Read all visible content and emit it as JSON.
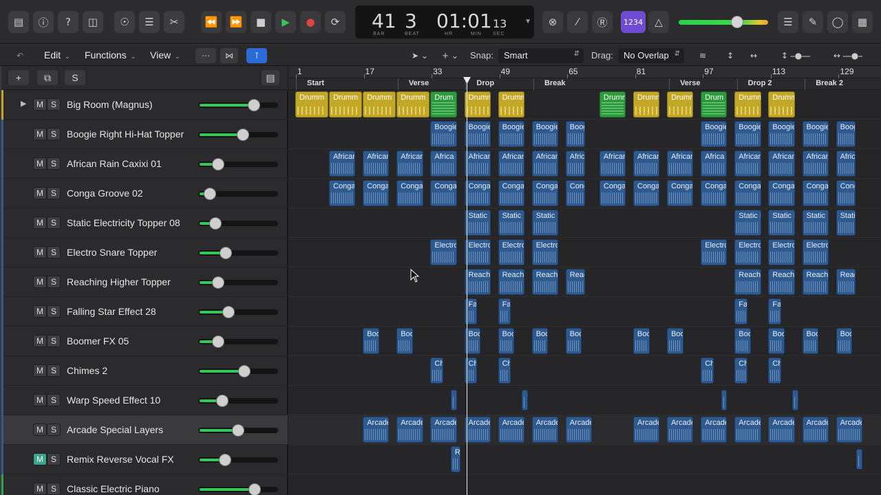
{
  "lcd": {
    "bar": "41",
    "beat": "3",
    "bar_label": "BAR",
    "beat_label": "BEAT",
    "time": "01:01",
    "time_frames": "13",
    "hr_label": "HR",
    "min_label": "MIN",
    "sec_label": "SEC"
  },
  "topbar": {
    "count_in_label": "1234",
    "master_volume_fraction": 0.68
  },
  "toolbar2": {
    "edit": "Edit",
    "functions": "Functions",
    "view": "View",
    "snap_label": "Snap:",
    "snap_value": "Smart",
    "drag_label": "Drag:",
    "drag_value": "No Overlap"
  },
  "header": {
    "s_button": "S"
  },
  "ruler": [
    "1",
    "17",
    "33",
    "49",
    "65",
    "81",
    "97",
    "113",
    "129"
  ],
  "markers": [
    "Start",
    "Verse",
    "Drop",
    "Break",
    "Verse",
    "Drop 2",
    "Break 2"
  ],
  "tracks": [
    {
      "name": "Big Room (Magnus)",
      "m": "M",
      "s": "S",
      "color": "#c3a726",
      "level": 0.72,
      "muted": false
    },
    {
      "name": "Boogie Right Hi-Hat Topper",
      "m": "M",
      "s": "S",
      "color": "#2e5a8f",
      "level": 0.58,
      "muted": false
    },
    {
      "name": "African Rain Caxixi 01",
      "m": "M",
      "s": "S",
      "color": "#2e5a8f",
      "level": 0.26,
      "muted": false
    },
    {
      "name": "Conga Groove 02",
      "m": "M",
      "s": "S",
      "color": "#2e5a8f",
      "level": 0.15,
      "muted": false
    },
    {
      "name": "Static Electricity Topper 08",
      "m": "M",
      "s": "S",
      "color": "#2e5a8f",
      "level": 0.22,
      "muted": false
    },
    {
      "name": "Electro Snare Topper",
      "m": "M",
      "s": "S",
      "color": "#2e5a8f",
      "level": 0.36,
      "muted": false
    },
    {
      "name": "Reaching Higher Topper",
      "m": "M",
      "s": "S",
      "color": "#2e5a8f",
      "level": 0.26,
      "muted": false
    },
    {
      "name": "Falling Star Effect 28",
      "m": "M",
      "s": "S",
      "color": "#2e5a8f",
      "level": 0.39,
      "muted": false
    },
    {
      "name": "Boomer FX 05",
      "m": "M",
      "s": "S",
      "color": "#2e5a8f",
      "level": 0.26,
      "muted": false
    },
    {
      "name": "Chimes 2",
      "m": "M",
      "s": "S",
      "color": "#2e5a8f",
      "level": 0.6,
      "muted": false
    },
    {
      "name": "Warp Speed Effect 10",
      "m": "M",
      "s": "S",
      "color": "#2e5a8f",
      "level": 0.31,
      "muted": false
    },
    {
      "name": "Arcade Special Layers",
      "m": "M",
      "s": "S",
      "color": "#2e5a8f",
      "level": 0.52,
      "muted": false
    },
    {
      "name": "Remix Reverse Vocal FX",
      "m": "M",
      "s": "S",
      "color": "#2e5a8f",
      "level": 0.35,
      "muted": true
    },
    {
      "name": "Classic Electric Piano",
      "m": "M",
      "s": "S",
      "color": "#2fa14a",
      "level": 0.73,
      "muted": false
    }
  ],
  "regions": [
    [
      {
        "label": "Drumm",
        "k": "drum",
        "b": 1,
        "e": 6
      },
      {
        "label": "Drumm",
        "k": "drum",
        "b": 6,
        "e": 11
      },
      {
        "label": "Drumm",
        "k": "drum",
        "b": 11,
        "e": 16
      },
      {
        "label": "Drumm",
        "k": "drum",
        "b": 16,
        "e": 21
      },
      {
        "label": "Drum",
        "k": "drumg",
        "b": 21,
        "e": 25
      },
      {
        "label": "Drumm",
        "k": "drum",
        "b": 26,
        "e": 30
      },
      {
        "label": "Drumm",
        "k": "drum",
        "b": 31,
        "e": 35
      },
      {
        "label": "Drumm",
        "k": "drumg",
        "b": 46,
        "e": 50
      },
      {
        "label": "Drumm",
        "k": "drum",
        "b": 51,
        "e": 55
      },
      {
        "label": "Drumm",
        "k": "drum",
        "b": 56,
        "e": 60
      },
      {
        "label": "Drum",
        "k": "drumg",
        "b": 61,
        "e": 65
      },
      {
        "label": "Drumm",
        "k": "drum",
        "b": 66,
        "e": 70
      },
      {
        "label": "Drumm",
        "k": "drum",
        "b": 71,
        "e": 75
      }
    ],
    [
      {
        "label": "Boogie",
        "k": "audio",
        "b": 21,
        "e": 25
      },
      {
        "label": "Boogie",
        "k": "audio",
        "b": 26,
        "e": 30
      },
      {
        "label": "Boogie",
        "k": "audio",
        "b": 31,
        "e": 35
      },
      {
        "label": "Boogie",
        "k": "audio",
        "b": 36,
        "e": 40
      },
      {
        "label": "Boogi",
        "k": "audio",
        "b": 41,
        "e": 44
      },
      {
        "label": "Boogie",
        "k": "audio",
        "b": 61,
        "e": 65
      },
      {
        "label": "Boogie",
        "k": "audio",
        "b": 66,
        "e": 70
      },
      {
        "label": "Boogie",
        "k": "audio",
        "b": 71,
        "e": 75
      },
      {
        "label": "Boogie",
        "k": "audio",
        "b": 76,
        "e": 80
      },
      {
        "label": "Boogi",
        "k": "audio",
        "b": 81,
        "e": 84
      }
    ],
    [
      {
        "label": "African",
        "k": "audio",
        "b": 6,
        "e": 10
      },
      {
        "label": "African",
        "k": "audio",
        "b": 11,
        "e": 15
      },
      {
        "label": "African",
        "k": "audio",
        "b": 16,
        "e": 20
      },
      {
        "label": "Africa",
        "k": "audio",
        "b": 21,
        "e": 25
      },
      {
        "label": "African",
        "k": "audio",
        "b": 26,
        "e": 30
      },
      {
        "label": "African",
        "k": "audio",
        "b": 31,
        "e": 35
      },
      {
        "label": "African",
        "k": "audio",
        "b": 36,
        "e": 40
      },
      {
        "label": "Africa",
        "k": "audio",
        "b": 41,
        "e": 44
      },
      {
        "label": "African",
        "k": "audio",
        "b": 46,
        "e": 50
      },
      {
        "label": "African",
        "k": "audio",
        "b": 51,
        "e": 55
      },
      {
        "label": "African",
        "k": "audio",
        "b": 56,
        "e": 60
      },
      {
        "label": "Africa",
        "k": "audio",
        "b": 61,
        "e": 65
      },
      {
        "label": "African",
        "k": "audio",
        "b": 66,
        "e": 70
      },
      {
        "label": "African",
        "k": "audio",
        "b": 71,
        "e": 75
      },
      {
        "label": "African",
        "k": "audio",
        "b": 76,
        "e": 80
      },
      {
        "label": "Africa",
        "k": "audio",
        "b": 81,
        "e": 84
      }
    ],
    [
      {
        "label": "Conga",
        "k": "audio",
        "b": 6,
        "e": 10
      },
      {
        "label": "Conga",
        "k": "audio",
        "b": 11,
        "e": 15
      },
      {
        "label": "Conga",
        "k": "audio",
        "b": 16,
        "e": 20
      },
      {
        "label": "Conga",
        "k": "audio",
        "b": 21,
        "e": 25
      },
      {
        "label": "Conga",
        "k": "audio",
        "b": 26,
        "e": 30
      },
      {
        "label": "Conga",
        "k": "audio",
        "b": 31,
        "e": 35
      },
      {
        "label": "Conga",
        "k": "audio",
        "b": 36,
        "e": 40
      },
      {
        "label": "Cong",
        "k": "audio",
        "b": 41,
        "e": 44
      },
      {
        "label": "Conga",
        "k": "audio",
        "b": 46,
        "e": 50
      },
      {
        "label": "Conga",
        "k": "audio",
        "b": 51,
        "e": 55
      },
      {
        "label": "Conga",
        "k": "audio",
        "b": 56,
        "e": 60
      },
      {
        "label": "Conga",
        "k": "audio",
        "b": 61,
        "e": 65
      },
      {
        "label": "Conga",
        "k": "audio",
        "b": 66,
        "e": 70
      },
      {
        "label": "Conga",
        "k": "audio",
        "b": 71,
        "e": 75
      },
      {
        "label": "Conga",
        "k": "audio",
        "b": 76,
        "e": 80
      },
      {
        "label": "Cong",
        "k": "audio",
        "b": 81,
        "e": 84
      }
    ],
    [
      {
        "label": "Static El",
        "k": "audio",
        "b": 26,
        "e": 30
      },
      {
        "label": "Static El",
        "k": "audio",
        "b": 31,
        "e": 35
      },
      {
        "label": "Static El",
        "k": "audio",
        "b": 36,
        "e": 40
      },
      {
        "label": "Static El",
        "k": "audio",
        "b": 66,
        "e": 70
      },
      {
        "label": "Static El",
        "k": "audio",
        "b": 71,
        "e": 75
      },
      {
        "label": "Static El",
        "k": "audio",
        "b": 76,
        "e": 80
      },
      {
        "label": "Static",
        "k": "audio",
        "b": 81,
        "e": 84
      }
    ],
    [
      {
        "label": "Electro",
        "k": "audio",
        "b": 21,
        "e": 25
      },
      {
        "label": "Electro",
        "k": "audio",
        "b": 26,
        "e": 30
      },
      {
        "label": "Electro",
        "k": "audio",
        "b": 31,
        "e": 35
      },
      {
        "label": "Electro",
        "k": "audio",
        "b": 36,
        "e": 40
      },
      {
        "label": "Electro",
        "k": "audio",
        "b": 61,
        "e": 65
      },
      {
        "label": "Electro",
        "k": "audio",
        "b": 66,
        "e": 70
      },
      {
        "label": "Electro",
        "k": "audio",
        "b": 71,
        "e": 75
      },
      {
        "label": "Electro",
        "k": "audio",
        "b": 76,
        "e": 80
      }
    ],
    [
      {
        "label": "Reachin",
        "k": "audio",
        "b": 26,
        "e": 30
      },
      {
        "label": "Reachin",
        "k": "audio",
        "b": 31,
        "e": 35
      },
      {
        "label": "Reachin",
        "k": "audio",
        "b": 36,
        "e": 40
      },
      {
        "label": "Reac",
        "k": "audio",
        "b": 41,
        "e": 44
      },
      {
        "label": "Reachin",
        "k": "audio",
        "b": 66,
        "e": 70
      },
      {
        "label": "Reachin",
        "k": "audio",
        "b": 71,
        "e": 75
      },
      {
        "label": "Reachin",
        "k": "audio",
        "b": 76,
        "e": 80
      },
      {
        "label": "Reac",
        "k": "audio",
        "b": 81,
        "e": 84
      }
    ],
    [
      {
        "label": "Fall",
        "k": "audio",
        "b": 26,
        "e": 28
      },
      {
        "label": "Fall",
        "k": "audio",
        "b": 31,
        "e": 33
      },
      {
        "label": "Fall",
        "k": "audio",
        "b": 66,
        "e": 68
      },
      {
        "label": "Fall",
        "k": "audio",
        "b": 71,
        "e": 73
      }
    ],
    [
      {
        "label": "Boo",
        "k": "audio",
        "b": 11,
        "e": 13.5
      },
      {
        "label": "Boo",
        "k": "audio",
        "b": 16,
        "e": 18.5
      },
      {
        "label": "Boo",
        "k": "audio",
        "b": 26,
        "e": 28.5
      },
      {
        "label": "Boo",
        "k": "audio",
        "b": 31,
        "e": 33.5
      },
      {
        "label": "Boo",
        "k": "audio",
        "b": 36,
        "e": 38.5
      },
      {
        "label": "Boo",
        "k": "audio",
        "b": 41,
        "e": 43.5
      },
      {
        "label": "Boo",
        "k": "audio",
        "b": 51,
        "e": 53.5
      },
      {
        "label": "Boo",
        "k": "audio",
        "b": 56,
        "e": 58.5
      },
      {
        "label": "Boo",
        "k": "audio",
        "b": 66,
        "e": 68.5
      },
      {
        "label": "Boo",
        "k": "audio",
        "b": 71,
        "e": 73.5
      },
      {
        "label": "Boo",
        "k": "audio",
        "b": 76,
        "e": 78.5
      },
      {
        "label": "Boo",
        "k": "audio",
        "b": 81,
        "e": 83.5
      }
    ],
    [
      {
        "label": "Chi",
        "k": "audio",
        "b": 21,
        "e": 23
      },
      {
        "label": "Chi",
        "k": "audio",
        "b": 26,
        "e": 28
      },
      {
        "label": "Chi",
        "k": "audio",
        "b": 31,
        "e": 33
      },
      {
        "label": "Chi",
        "k": "audio",
        "b": 61,
        "e": 63
      },
      {
        "label": "Chi",
        "k": "audio",
        "b": 66,
        "e": 68
      },
      {
        "label": "Chi",
        "k": "audio",
        "b": 71,
        "e": 73
      }
    ],
    [
      {
        "label": "",
        "k": "audio",
        "b": 24,
        "e": 25
      },
      {
        "label": "",
        "k": "audio",
        "b": 34.5,
        "e": 35.5
      },
      {
        "label": "",
        "k": "audio",
        "b": 64,
        "e": 65
      },
      {
        "label": "",
        "k": "audio",
        "b": 74.5,
        "e": 75.5
      }
    ],
    [
      {
        "label": "Arcade",
        "k": "audio",
        "b": 11,
        "e": 15
      },
      {
        "label": "Arcade",
        "k": "audio",
        "b": 16,
        "e": 20
      },
      {
        "label": "Arcade",
        "k": "audio",
        "b": 21,
        "e": 25
      },
      {
        "label": "Arcade",
        "k": "audio",
        "b": 26,
        "e": 30
      },
      {
        "label": "Arcade",
        "k": "audio",
        "b": 31,
        "e": 35
      },
      {
        "label": "Arcade",
        "k": "audio",
        "b": 36,
        "e": 40
      },
      {
        "label": "Arcade",
        "k": "audio",
        "b": 41,
        "e": 45
      },
      {
        "label": "Arcade",
        "k": "audio",
        "b": 51,
        "e": 55
      },
      {
        "label": "Arcade",
        "k": "audio",
        "b": 56,
        "e": 60
      },
      {
        "label": "Arcade",
        "k": "audio",
        "b": 61,
        "e": 65
      },
      {
        "label": "Arcade",
        "k": "audio",
        "b": 66,
        "e": 70
      },
      {
        "label": "Arcade",
        "k": "audio",
        "b": 71,
        "e": 75
      },
      {
        "label": "Arcade",
        "k": "audio",
        "b": 76,
        "e": 80
      },
      {
        "label": "Arcade",
        "k": "audio",
        "b": 81,
        "e": 85
      }
    ],
    [
      {
        "label": "Re",
        "k": "audio",
        "b": 24,
        "e": 25.5
      },
      {
        "label": "",
        "k": "audio",
        "b": 84,
        "e": 85
      }
    ],
    []
  ],
  "colors": {
    "accent_blue": "#2a6bd6",
    "drum_yellow": "#c3a726",
    "drum_green": "#2e9a3e",
    "audio_blue": "#2e5a8f",
    "meter_green": "#34c759",
    "record_red": "#e0463f"
  },
  "icons": [
    "library-icon",
    "info-icon",
    "help-icon",
    "inbox-icon",
    "smart-controls-icon",
    "mixer-icon",
    "scissors-icon",
    "rewind-icon",
    "fast-forward-icon",
    "stop-icon",
    "play-icon",
    "record-icon",
    "cycle-icon",
    "close-circle-icon",
    "tuner-icon",
    "score-icon",
    "metronome-icon",
    "list-icon",
    "notepad-icon",
    "loop-browser-icon",
    "browser-icon"
  ]
}
